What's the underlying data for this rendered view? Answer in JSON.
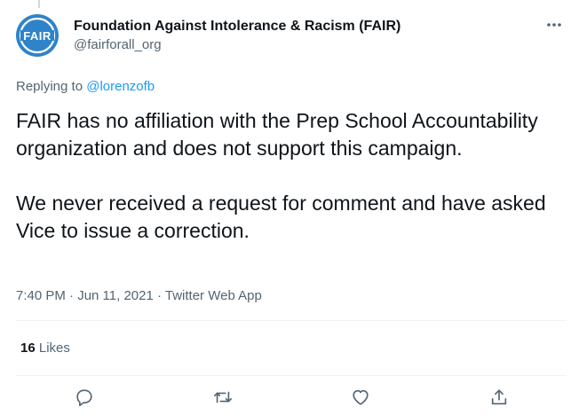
{
  "tweet": {
    "author": {
      "display_name": "Foundation Against Intolerance & Racism (FAIR)",
      "handle": "@fairforall_org",
      "avatar_text": "FAIR"
    },
    "reply": {
      "prefix": "Replying to",
      "mention": "@lorenzofb"
    },
    "text": [
      "FAIR has no affiliation with the Prep School Accountability organization and does not support this campaign.",
      "We never received a request for comment and have asked Vice to issue a correction."
    ],
    "timestamp": "7:40 PM · Jun 11, 2021 · Twitter Web App",
    "likes": {
      "count": "16",
      "label": "Likes"
    },
    "actions": [
      {
        "name": "reply",
        "icon": "reply-icon"
      },
      {
        "name": "retweet",
        "icon": "retweet-icon"
      },
      {
        "name": "like",
        "icon": "heart-icon"
      },
      {
        "name": "share",
        "icon": "share-icon"
      }
    ]
  },
  "colors": {
    "text": "#0f1419",
    "secondary": "#536471",
    "link": "#1d9bf0",
    "divider": "#eff3f4",
    "avatar_bg": "#2f83c9"
  }
}
